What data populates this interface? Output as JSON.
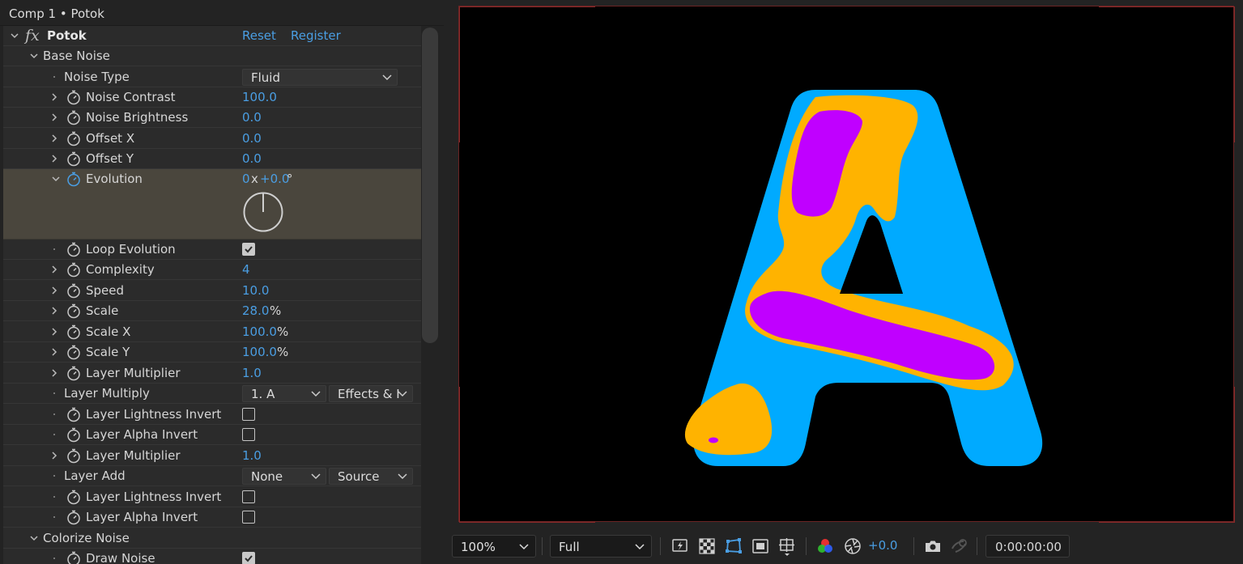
{
  "panel": {
    "title": "Comp 1 • Potok",
    "effect": {
      "name": "Potok",
      "reset": "Reset",
      "register": "Register"
    }
  },
  "rows": {
    "base_noise": "Base Noise",
    "noise_type": {
      "label": "Noise Type",
      "value": "Fluid"
    },
    "noise_contrast": {
      "label": "Noise Contrast",
      "value": "100.0"
    },
    "noise_brightness": {
      "label": "Noise Brightness",
      "value": "0.0"
    },
    "offset_x": {
      "label": "Offset X",
      "value": "0.0"
    },
    "offset_y": {
      "label": "Offset Y",
      "value": "0.0"
    },
    "evolution": {
      "label": "Evolution",
      "revolutions": "0",
      "x": "x",
      "degrees": "+0.0",
      "unit": "°"
    },
    "loop_evolution": {
      "label": "Loop Evolution",
      "checked": true
    },
    "complexity": {
      "label": "Complexity",
      "value": "4"
    },
    "speed": {
      "label": "Speed",
      "value": "10.0"
    },
    "scale": {
      "label": "Scale",
      "value": "28.0",
      "unit": "%"
    },
    "scale_x": {
      "label": "Scale X",
      "value": "100.0",
      "unit": "%"
    },
    "scale_y": {
      "label": "Scale Y",
      "value": "100.0",
      "unit": "%"
    },
    "layer_multiplier_1": {
      "label": "Layer Multiplier",
      "value": "1.0"
    },
    "layer_multiply": {
      "label": "Layer Multiply",
      "layer": "1. A",
      "source": "Effects & I"
    },
    "layer_lightness_invert_1": {
      "label": "Layer Lightness Invert",
      "checked": false
    },
    "layer_alpha_invert_1": {
      "label": "Layer Alpha Invert",
      "checked": false
    },
    "layer_multiplier_2": {
      "label": "Layer Multiplier",
      "value": "1.0"
    },
    "layer_add": {
      "label": "Layer Add",
      "layer": "None",
      "source": "Source"
    },
    "layer_lightness_invert_2": {
      "label": "Layer Lightness Invert",
      "checked": false
    },
    "layer_alpha_invert_2": {
      "label": "Layer Alpha Invert",
      "checked": false
    },
    "colorize_noise": "Colorize Noise",
    "draw_noise": {
      "label": "Draw Noise",
      "checked": true
    }
  },
  "viewer": {
    "zoom": "100%",
    "resolution": "Full",
    "exposure": "+0.0",
    "timecode": "0:00:00:00",
    "icons": [
      "fast-previews-icon",
      "transparency-grid-icon",
      "mask-path-icon",
      "region-of-interest-icon",
      "grid-guides-icon",
      "color-channels-icon",
      "reset-exposure-icon",
      "snapshot-icon",
      "show-snapshot-icon"
    ]
  },
  "colors": {
    "accent_blue": "#4a9ee3",
    "letter_blue": "#00aaff",
    "letter_orange": "#ffb300",
    "letter_purple": "#c000ff"
  }
}
